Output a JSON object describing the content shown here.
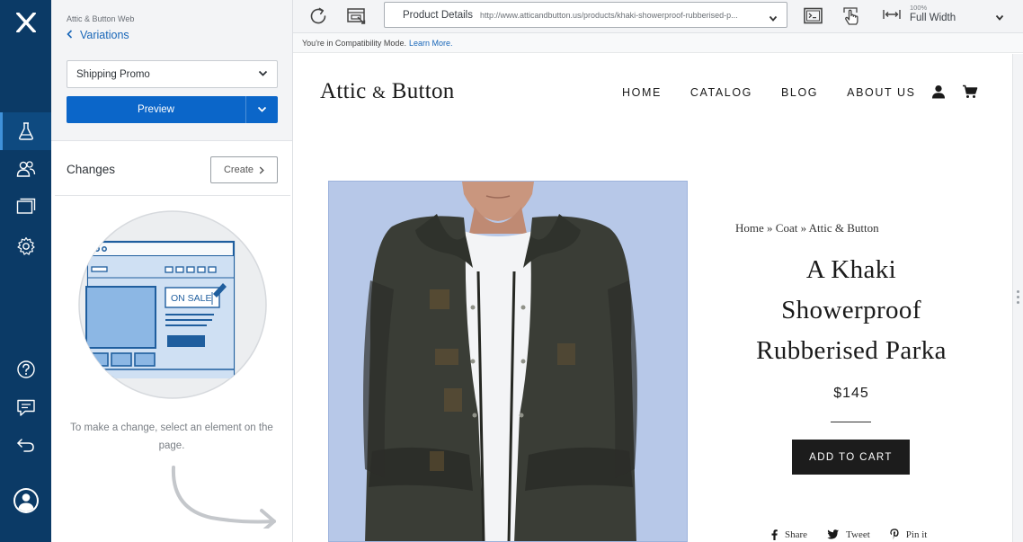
{
  "rail": {
    "items": [
      {
        "name": "experiments",
        "active": true
      },
      {
        "name": "audiences",
        "active": false
      },
      {
        "name": "pages",
        "active": false
      },
      {
        "name": "settings",
        "active": false
      },
      {
        "name": "help",
        "active": false
      },
      {
        "name": "feedback",
        "active": false
      },
      {
        "name": "exit",
        "active": false
      }
    ]
  },
  "panel": {
    "project_name": "Attic & Button Web",
    "back_label": "Variations",
    "variation_selected": "Shipping Promo",
    "preview_label": "Preview",
    "changes_title": "Changes",
    "create_label": "Create",
    "illustration_badge": "ON SALE",
    "hint": "To make a change, select an element on the page."
  },
  "toolbar": {
    "page_name": "Product Details",
    "url": "http://www.atticandbutton.us/products/khaki-showerproof-rubberised-p...",
    "width_percent": "100%",
    "width_label": "Full Width"
  },
  "compat": {
    "message": "You're in Compatibility Mode.",
    "link": "Learn More."
  },
  "site": {
    "brand_left": "Attic",
    "brand_amp": "&",
    "brand_right": "Button",
    "nav": [
      "HOME",
      "CATALOG",
      "BLOG",
      "ABOUT US"
    ],
    "breadcrumb": [
      "Home",
      "Coat",
      "Attic & Button"
    ],
    "breadcrumb_sep": "»",
    "title_lines": [
      "A Khaki",
      "Showerproof",
      "Rubberised Parka"
    ],
    "price": "$145",
    "add_to_cart": "ADD TO CART",
    "share": [
      "Share",
      "Tweet",
      "Pin it"
    ]
  },
  "colors": {
    "rail": "#0b3a66",
    "primary": "#0b66c9",
    "link": "#1866b8",
    "photo_bg": "#b7c8e8",
    "jacket": "#3a3d36",
    "button_dark": "#1c1c1c"
  }
}
